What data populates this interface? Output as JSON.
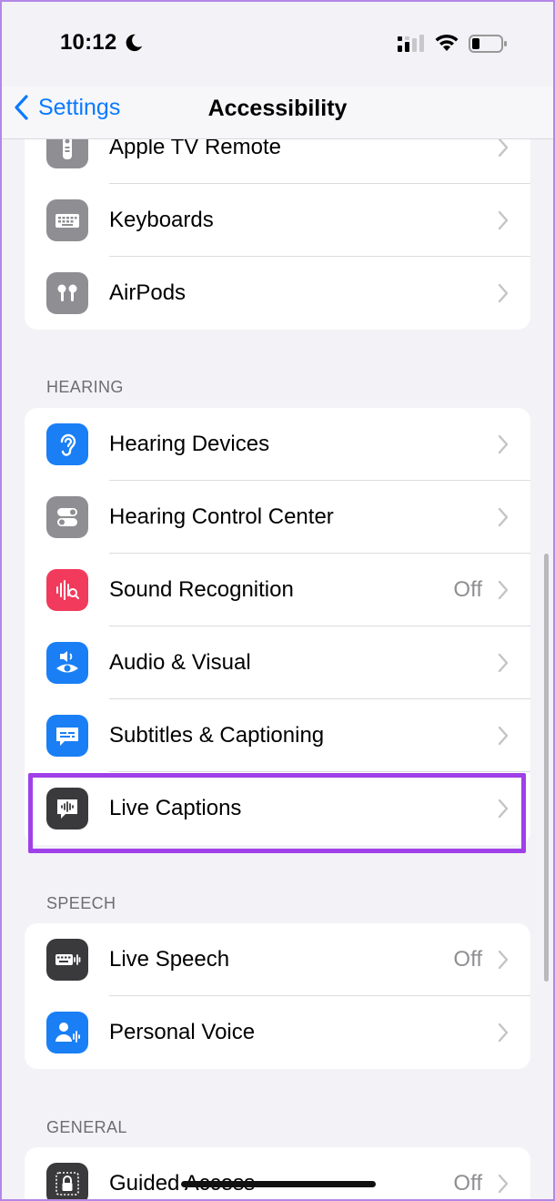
{
  "status_bar": {
    "time": "10:12"
  },
  "nav": {
    "back_label": "Settings",
    "title": "Accessibility"
  },
  "groups": {
    "top": {
      "items": [
        {
          "label": "Apple TV Remote",
          "icon": "remote-icon",
          "color": "#8e8e93"
        },
        {
          "label": "Keyboards",
          "icon": "keyboard-icon",
          "color": "#8e8e93"
        },
        {
          "label": "AirPods",
          "icon": "airpods-icon",
          "color": "#8e8e93"
        }
      ]
    },
    "hearing": {
      "header": "HEARING",
      "items": [
        {
          "label": "Hearing Devices",
          "icon": "ear-icon",
          "color": "#1a7ff5"
        },
        {
          "label": "Hearing Control Center",
          "icon": "toggles-icon",
          "color": "#8e8e93"
        },
        {
          "label": "Sound Recognition",
          "value": "Off",
          "icon": "sound-wave-icon",
          "color": "#f23a5c"
        },
        {
          "label": "Audio & Visual",
          "icon": "speaker-eye-icon",
          "color": "#1a7ff5"
        },
        {
          "label": "Subtitles & Captioning",
          "icon": "caption-bubble-icon",
          "color": "#1a7ff5"
        },
        {
          "label": "Live Captions",
          "icon": "live-caption-icon",
          "color": "#3a3a3c"
        }
      ]
    },
    "speech": {
      "header": "SPEECH",
      "items": [
        {
          "label": "Live Speech",
          "value": "Off",
          "icon": "keyboard-wave-icon",
          "color": "#3a3a3c"
        },
        {
          "label": "Personal Voice",
          "icon": "person-wave-icon",
          "color": "#1a7ff5"
        }
      ]
    },
    "general": {
      "header": "GENERAL",
      "items": [
        {
          "label": "Guided Access",
          "value": "Off",
          "icon": "lock-icon",
          "color": "#3a3a3c"
        }
      ]
    }
  },
  "colors": {
    "accent": "#0a7aff",
    "highlight": "#a040e8",
    "background": "#f2f2f7"
  }
}
